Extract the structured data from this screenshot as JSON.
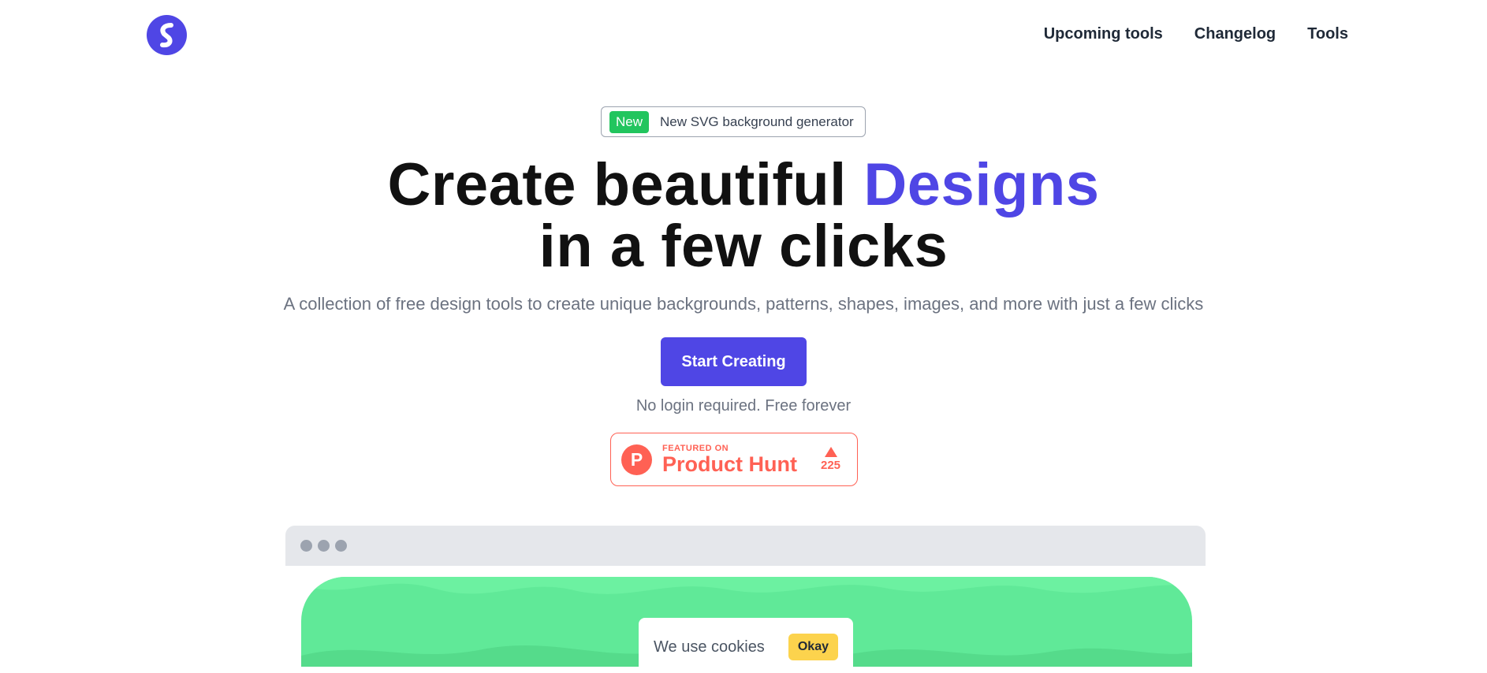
{
  "nav": {
    "items": [
      "Upcoming tools",
      "Changelog",
      "Tools"
    ]
  },
  "badge": {
    "tag": "New",
    "text": "New SVG background generator"
  },
  "hero": {
    "title_line1_prefix": "Create beautiful ",
    "title_line1_accent": "Designs",
    "title_line2": "in a few clicks",
    "subtitle": "A collection of free design tools to create unique backgrounds, patterns, shapes, images, and more with just a few clicks"
  },
  "cta": {
    "label": "Start Creating",
    "note": "No login required. Free forever"
  },
  "product_hunt": {
    "featured": "FEATURED ON",
    "name": "Product Hunt",
    "logo_letter": "P",
    "votes": "225"
  },
  "cookie": {
    "text": "We use cookies",
    "button": "Okay"
  },
  "colors": {
    "accent": "#4f46e5",
    "badge_green": "#22c55e",
    "product_hunt": "#ff6154",
    "preview_green": "#60e998",
    "okay_yellow": "#fcd34d"
  }
}
